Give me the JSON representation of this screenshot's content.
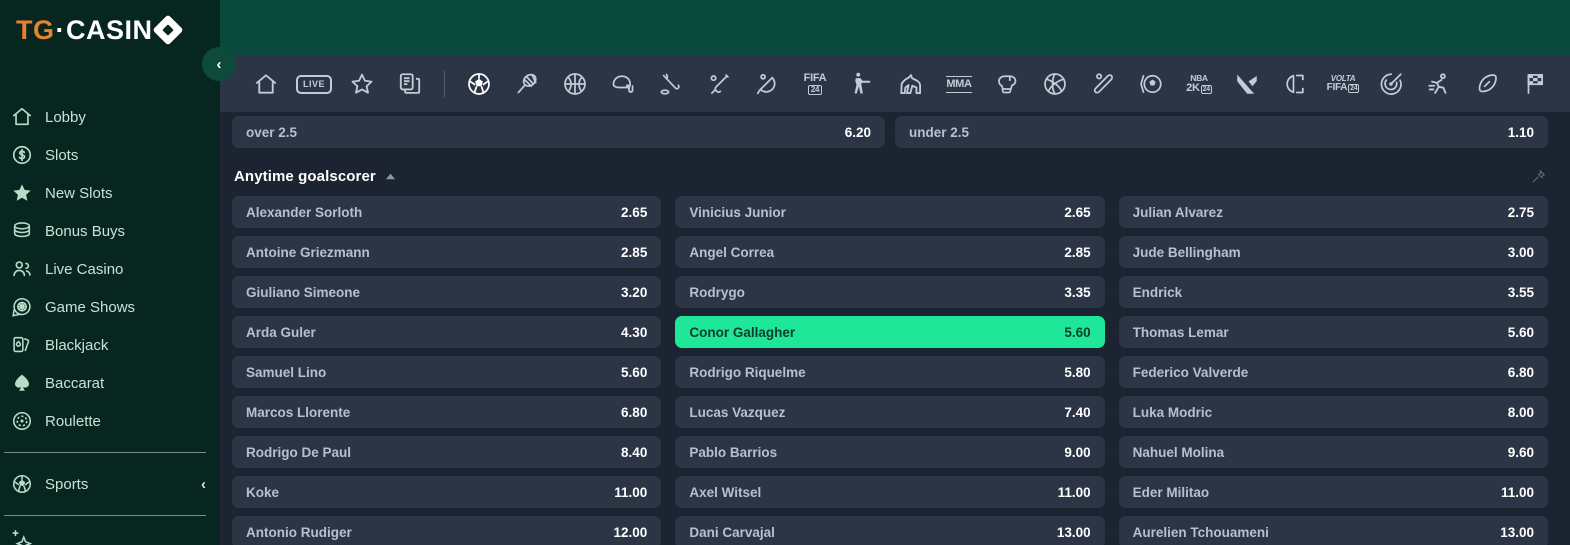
{
  "brand": {
    "logo_primary": "TG",
    "logo_separator": "·",
    "logo_secondary": "CASIN",
    "accent_orange": "#e8822c",
    "accent_green": "#1fe79a",
    "sidebar_bg": "#072620",
    "header_bg": "#0a4a3d",
    "content_bg": "#1b2430",
    "row_bg": "#2b3545"
  },
  "sidebar": {
    "collapse_button": "‹",
    "items": [
      {
        "label": "Lobby",
        "icon": "home-icon"
      },
      {
        "label": "Slots",
        "icon": "coin-dollar-icon"
      },
      {
        "label": "New Slots",
        "icon": "star-icon"
      },
      {
        "label": "Bonus Buys",
        "icon": "coins-stack-icon"
      },
      {
        "label": "Live Casino",
        "icon": "people-icon"
      },
      {
        "label": "Game Shows",
        "icon": "wheel-icon"
      },
      {
        "label": "Blackjack",
        "icon": "cards-icon"
      },
      {
        "label": "Baccarat",
        "icon": "spade-icon"
      },
      {
        "label": "Roulette",
        "icon": "roulette-chip-icon"
      }
    ],
    "sports_item": {
      "label": "Sports",
      "icon": "soccer-ball-icon",
      "chevron": "‹"
    }
  },
  "icon_bar": {
    "items": [
      {
        "name": "home-icon",
        "kind": "svg",
        "label": "Home"
      },
      {
        "name": "live-icon",
        "kind": "badge",
        "label": "LIVE"
      },
      {
        "name": "favourites-icon",
        "kind": "svg",
        "label": "Favourites"
      },
      {
        "name": "bet-slips-icon",
        "kind": "svg",
        "label": "My Bets"
      },
      {
        "name": "divider",
        "kind": "sep",
        "label": ""
      },
      {
        "name": "soccer-icon",
        "kind": "svg",
        "label": "Football",
        "active": true
      },
      {
        "name": "tennis-icon",
        "kind": "svg",
        "label": "Tennis"
      },
      {
        "name": "basketball-icon",
        "kind": "svg",
        "label": "Basketball"
      },
      {
        "name": "american-football-icon",
        "kind": "svg",
        "label": "American Football"
      },
      {
        "name": "ice-hockey-icon",
        "kind": "svg",
        "label": "Ice Hockey"
      },
      {
        "name": "cricket-icon",
        "kind": "svg",
        "label": "Cricket"
      },
      {
        "name": "table-tennis-icon",
        "kind": "svg",
        "label": "Table Tennis"
      },
      {
        "name": "fifa24-icon",
        "kind": "text",
        "label": "FIFA",
        "sub": "24"
      },
      {
        "name": "counter-strike-icon",
        "kind": "svg",
        "label": "Counter-Strike"
      },
      {
        "name": "horse-racing-icon",
        "kind": "svg",
        "label": "Horse Racing"
      },
      {
        "name": "mma-icon",
        "kind": "text",
        "label": "MMA"
      },
      {
        "name": "boxing-icon",
        "kind": "svg",
        "label": "Boxing"
      },
      {
        "name": "volleyball-icon",
        "kind": "svg",
        "label": "Volleyball"
      },
      {
        "name": "baseball-icon",
        "kind": "svg",
        "label": "Baseball"
      },
      {
        "name": "efootball-icon",
        "kind": "svg",
        "label": "eFootball"
      },
      {
        "name": "nba2k24-icon",
        "kind": "text",
        "label": "NBA",
        "sub": "2K",
        "sub2": "24"
      },
      {
        "name": "valorant-icon",
        "kind": "svg",
        "label": "Valorant"
      },
      {
        "name": "league-of-legends-icon",
        "kind": "svg",
        "label": "League of Legends"
      },
      {
        "name": "volta-fifa24-icon",
        "kind": "text",
        "label": "VOLTA",
        "sub": "FIFA",
        "sub2": "24"
      },
      {
        "name": "darts-icon",
        "kind": "svg",
        "label": "Darts"
      },
      {
        "name": "athletics-icon",
        "kind": "svg",
        "label": "Athletics"
      },
      {
        "name": "rugby-icon",
        "kind": "svg",
        "label": "Rugby"
      },
      {
        "name": "motorsport-icon",
        "kind": "svg",
        "label": "Motorsport"
      },
      {
        "name": "golf-icon",
        "kind": "svg",
        "label": "Golf"
      }
    ]
  },
  "over_under": {
    "over": {
      "name": "over 2.5",
      "odds": "6.20"
    },
    "under": {
      "name": "under 2.5",
      "odds": "1.10"
    }
  },
  "market": {
    "title": "Anytime goalscorer",
    "collapse_chevron": "collapse-chevron-icon",
    "pin": "pin-icon",
    "columns": [
      [
        {
          "name": "Alexander Sorloth",
          "odds": "2.65",
          "selected": false
        },
        {
          "name": "Antoine Griezmann",
          "odds": "2.85",
          "selected": false
        },
        {
          "name": "Giuliano Simeone",
          "odds": "3.20",
          "selected": false
        },
        {
          "name": "Arda Guler",
          "odds": "4.30",
          "selected": false
        },
        {
          "name": "Samuel Lino",
          "odds": "5.60",
          "selected": false
        },
        {
          "name": "Marcos Llorente",
          "odds": "6.80",
          "selected": false
        },
        {
          "name": "Rodrigo De Paul",
          "odds": "8.40",
          "selected": false
        },
        {
          "name": "Koke",
          "odds": "11.00",
          "selected": false
        },
        {
          "name": "Antonio Rudiger",
          "odds": "12.00",
          "selected": false
        }
      ],
      [
        {
          "name": "Vinicius Junior",
          "odds": "2.65",
          "selected": false
        },
        {
          "name": "Angel Correa",
          "odds": "2.85",
          "selected": false
        },
        {
          "name": "Rodrygo",
          "odds": "3.35",
          "selected": false
        },
        {
          "name": "Conor Gallagher",
          "odds": "5.60",
          "selected": true
        },
        {
          "name": "Rodrigo Riquelme",
          "odds": "5.80",
          "selected": false
        },
        {
          "name": "Lucas Vazquez",
          "odds": "7.40",
          "selected": false
        },
        {
          "name": "Pablo Barrios",
          "odds": "9.00",
          "selected": false
        },
        {
          "name": "Axel Witsel",
          "odds": "11.00",
          "selected": false
        },
        {
          "name": "Dani Carvajal",
          "odds": "13.00",
          "selected": false
        }
      ],
      [
        {
          "name": "Julian Alvarez",
          "odds": "2.75",
          "selected": false
        },
        {
          "name": "Jude Bellingham",
          "odds": "3.00",
          "selected": false
        },
        {
          "name": "Endrick",
          "odds": "3.55",
          "selected": false
        },
        {
          "name": "Thomas Lemar",
          "odds": "5.60",
          "selected": false
        },
        {
          "name": "Federico Valverde",
          "odds": "6.80",
          "selected": false
        },
        {
          "name": "Luka Modric",
          "odds": "8.00",
          "selected": false
        },
        {
          "name": "Nahuel Molina",
          "odds": "9.60",
          "selected": false
        },
        {
          "name": "Eder Militao",
          "odds": "11.00",
          "selected": false
        },
        {
          "name": "Aurelien Tchouameni",
          "odds": "13.00",
          "selected": false
        }
      ]
    ]
  }
}
